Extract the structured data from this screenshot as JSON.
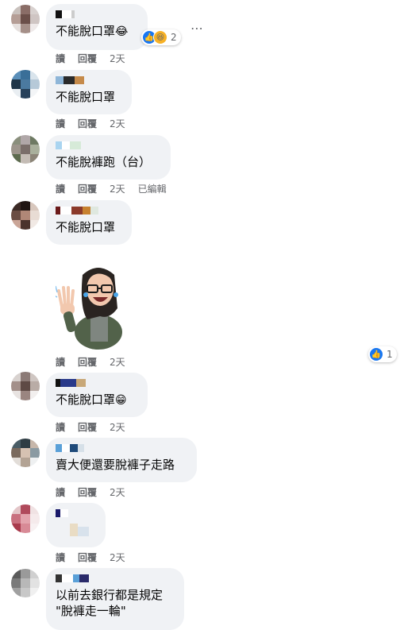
{
  "comments": [
    {
      "text": "不能脫口罩",
      "emoji": "😂",
      "actions": [
        "讀",
        "回覆",
        "2天"
      ],
      "reaction_count": "2"
    },
    {
      "text": "不能脫口罩",
      "actions": [
        "讀",
        "回覆",
        "2天"
      ]
    },
    {
      "text": "不能脫褲跑（台）",
      "actions": [
        "讀",
        "回覆",
        "2天",
        "已編輯"
      ]
    },
    {
      "text": "不能脫口罩",
      "actions": [
        "讀",
        "回覆",
        "2天"
      ],
      "sticker": "woman-laughing-waving-sticker",
      "reaction_count": "1"
    },
    {
      "text": "不能脫口罩",
      "emoji": "😁",
      "actions": [
        "讀",
        "回覆",
        "2天"
      ]
    },
    {
      "text": "賣大便還要脫褲子走路",
      "actions": [
        "讀",
        "回覆",
        "2天"
      ]
    },
    {
      "text": "",
      "actions": [
        "讀",
        "回覆",
        "2天"
      ]
    },
    {
      "text": "以前去銀行都是規定\n\"脫褲走一輪\""
    }
  ],
  "icons": {
    "like": "like-icon",
    "haha": "haha-icon",
    "more": "more-options-icon"
  },
  "colors": {
    "bubble": "#f0f2f5",
    "meta": "#65676b",
    "like": "#1877f2"
  }
}
